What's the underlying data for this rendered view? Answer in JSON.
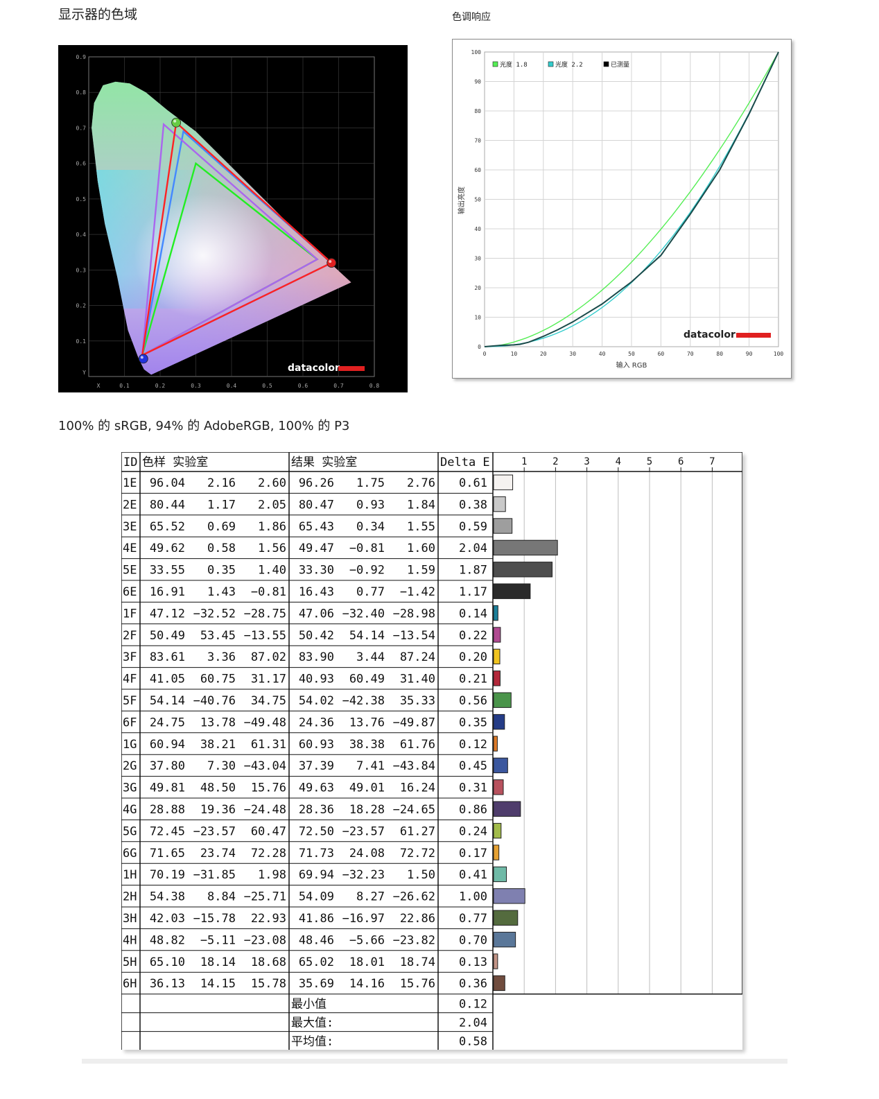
{
  "gamut_title": "显示器的色域",
  "tone_title": "色调响应",
  "coverage_text": "100% 的 sRGB, 94% 的 AdobeRGB, 100% 的 P3",
  "chart_data": [
    {
      "type": "scatter",
      "name": "gamut",
      "x_ticks": [
        "X",
        "0.1",
        "0.2",
        "0.3",
        "0.4",
        "0.5",
        "0.6",
        "0.7",
        "0.8"
      ],
      "y_ticks": [
        "Y",
        "0.1",
        "0.2",
        "0.3",
        "0.4",
        "0.5",
        "0.6",
        "0.7",
        "0.8",
        "0.9"
      ],
      "xlim": [
        0,
        0.8
      ],
      "ylim": [
        0,
        0.9
      ],
      "brand": "datacolor",
      "triangles": [
        {
          "color": "#22ee22",
          "points": [
            [
              0.64,
              0.33
            ],
            [
              0.3,
              0.6
            ],
            [
              0.15,
              0.06
            ]
          ]
        },
        {
          "color": "#4488ff",
          "points": [
            [
              0.68,
              0.32
            ],
            [
              0.265,
              0.69
            ],
            [
              0.15,
              0.06
            ]
          ]
        },
        {
          "color": "#aa66ee",
          "points": [
            [
              0.64,
              0.33
            ],
            [
              0.21,
              0.71
            ],
            [
              0.15,
              0.06
            ]
          ]
        },
        {
          "color": "#ff2222",
          "points": [
            [
              0.68,
              0.32
            ],
            [
              0.245,
              0.715
            ],
            [
              0.15,
              0.06
            ]
          ]
        }
      ],
      "markers": [
        {
          "color": "#e02020",
          "x": 0.68,
          "y": 0.32
        },
        {
          "color": "#66cc44",
          "x": 0.245,
          "y": 0.715
        },
        {
          "color": "#2233dd",
          "x": 0.153,
          "y": 0.05
        }
      ]
    },
    {
      "type": "line",
      "name": "tone",
      "xlabel": "输入 RGB",
      "ylabel": "输出亮度",
      "xlim": [
        0,
        100
      ],
      "ylim": [
        0,
        100
      ],
      "x_ticks": [
        "0",
        "10",
        "20",
        "30",
        "40",
        "50",
        "60",
        "70",
        "80",
        "90",
        "100"
      ],
      "y_ticks": [
        "0",
        "10",
        "20",
        "30",
        "40",
        "50",
        "60",
        "70",
        "80",
        "90",
        "100"
      ],
      "brand": "datacolor",
      "legend": [
        "光度 1.8",
        "光度 2.2",
        "已测量"
      ],
      "series": [
        {
          "name": "光度 1.8",
          "color": "#55ee55",
          "gamma": 1.8
        },
        {
          "name": "光度 2.2",
          "color": "#33cccc",
          "gamma": 2.2
        },
        {
          "name": "已测量",
          "color": "#1a4a4a",
          "x": [
            0,
            5,
            10,
            12,
            15,
            20,
            25,
            30,
            40,
            50,
            60,
            70,
            80,
            90,
            100
          ],
          "y": [
            0,
            0.4,
            0.6,
            0.8,
            1.5,
            3.5,
            5.8,
            8.4,
            14.5,
            22,
            31,
            45,
            60,
            79,
            100
          ]
        }
      ]
    },
    {
      "type": "table",
      "name": "deltae",
      "headers": {
        "id": "ID",
        "sample": "色样 实验室",
        "result": "结果 实验室",
        "delta": "Delta E"
      },
      "bar_ticks": [
        "1",
        "2",
        "3",
        "4",
        "5",
        "6",
        "7"
      ],
      "rows": [
        {
          "id": "1E",
          "s": [
            "96.04",
            "2.16",
            "2.60"
          ],
          "r": [
            "96.26",
            "1.75",
            "2.76"
          ],
          "de": "0.61",
          "color": "#f5f2f0"
        },
        {
          "id": "2E",
          "s": [
            "80.44",
            "1.17",
            "2.05"
          ],
          "r": [
            "80.47",
            "0.93",
            "1.84"
          ],
          "de": "0.38",
          "color": "#c9c9c9"
        },
        {
          "id": "3E",
          "s": [
            "65.52",
            "0.69",
            "1.86"
          ],
          "r": [
            "65.43",
            "0.34",
            "1.55"
          ],
          "de": "0.59",
          "color": "#9e9e9e"
        },
        {
          "id": "4E",
          "s": [
            "49.62",
            "0.58",
            "1.56"
          ],
          "r": [
            "49.47",
            "−0.81",
            "1.60"
          ],
          "de": "2.04",
          "color": "#777777"
        },
        {
          "id": "5E",
          "s": [
            "33.55",
            "0.35",
            "1.40"
          ],
          "r": [
            "33.30",
            "−0.92",
            "1.59"
          ],
          "de": "1.87",
          "color": "#4e4e4e"
        },
        {
          "id": "6E",
          "s": [
            "16.91",
            "1.43",
            "−0.81"
          ],
          "r": [
            "16.43",
            "0.77",
            "−1.42"
          ],
          "de": "1.17",
          "color": "#2a2a2a"
        },
        {
          "id": "1F",
          "s": [
            "47.12",
            "−32.52",
            "−28.75"
          ],
          "r": [
            "47.06",
            "−32.40",
            "−28.98"
          ],
          "de": "0.14",
          "color": "#1b7f9a"
        },
        {
          "id": "2F",
          "s": [
            "50.49",
            "53.45",
            "−13.55"
          ],
          "r": [
            "50.42",
            "54.14",
            "−13.54"
          ],
          "de": "0.22",
          "color": "#b04a91"
        },
        {
          "id": "3F",
          "s": [
            "83.61",
            "3.36",
            "87.02"
          ],
          "r": [
            "83.90",
            "3.44",
            "87.24"
          ],
          "de": "0.20",
          "color": "#f0c41f"
        },
        {
          "id": "4F",
          "s": [
            "41.05",
            "60.75",
            "31.17"
          ],
          "r": [
            "40.93",
            "60.49",
            "31.40"
          ],
          "de": "0.21",
          "color": "#b3283a"
        },
        {
          "id": "5F",
          "s": [
            "54.14",
            "−40.76",
            "34.75"
          ],
          "r": [
            "54.02",
            "−42.38",
            "35.33"
          ],
          "de": "0.56",
          "color": "#4a944a"
        },
        {
          "id": "6F",
          "s": [
            "24.75",
            "13.78",
            "−49.48"
          ],
          "r": [
            "24.36",
            "13.76",
            "−49.87"
          ],
          "de": "0.35",
          "color": "#253c86"
        },
        {
          "id": "1G",
          "s": [
            "60.94",
            "38.21",
            "61.31"
          ],
          "r": [
            "60.93",
            "38.38",
            "61.76"
          ],
          "de": "0.12",
          "color": "#dc7a28"
        },
        {
          "id": "2G",
          "s": [
            "37.80",
            "7.30",
            "−43.04"
          ],
          "r": [
            "37.39",
            "7.41",
            "−43.84"
          ],
          "de": "0.45",
          "color": "#3b579e"
        },
        {
          "id": "3G",
          "s": [
            "49.81",
            "48.50",
            "15.76"
          ],
          "r": [
            "49.63",
            "49.01",
            "16.24"
          ],
          "de": "0.31",
          "color": "#b8525e"
        },
        {
          "id": "4G",
          "s": [
            "28.88",
            "19.36",
            "−24.48"
          ],
          "r": [
            "28.36",
            "18.28",
            "−24.65"
          ],
          "de": "0.86",
          "color": "#4f3d6c"
        },
        {
          "id": "5G",
          "s": [
            "72.45",
            "−23.57",
            "60.47"
          ],
          "r": [
            "72.50",
            "−23.57",
            "61.27"
          ],
          "de": "0.24",
          "color": "#a2bb4a"
        },
        {
          "id": "6G",
          "s": [
            "71.65",
            "23.74",
            "72.28"
          ],
          "r": [
            "71.73",
            "24.08",
            "72.72"
          ],
          "de": "0.17",
          "color": "#e6a132"
        },
        {
          "id": "1H",
          "s": [
            "70.19",
            "−31.85",
            "1.98"
          ],
          "r": [
            "69.94",
            "−32.23",
            "1.50"
          ],
          "de": "0.41",
          "color": "#6fbaa7"
        },
        {
          "id": "2H",
          "s": [
            "54.38",
            "8.84",
            "−25.71"
          ],
          "r": [
            "54.09",
            "8.27",
            "−26.62"
          ],
          "de": "1.00",
          "color": "#7f80b0"
        },
        {
          "id": "3H",
          "s": [
            "42.03",
            "−15.78",
            "22.93"
          ],
          "r": [
            "41.86",
            "−16.97",
            "22.86"
          ],
          "de": "0.77",
          "color": "#546b3e"
        },
        {
          "id": "4H",
          "s": [
            "48.82",
            "−5.11",
            "−23.08"
          ],
          "r": [
            "48.46",
            "−5.66",
            "−23.82"
          ],
          "de": "0.70",
          "color": "#5a7799"
        },
        {
          "id": "5H",
          "s": [
            "65.10",
            "18.14",
            "18.68"
          ],
          "r": [
            "65.02",
            "18.01",
            "18.74"
          ],
          "de": "0.13",
          "color": "#c29486"
        },
        {
          "id": "6H",
          "s": [
            "36.13",
            "14.15",
            "15.78"
          ],
          "r": [
            "35.69",
            "14.16",
            "15.76"
          ],
          "de": "0.36",
          "color": "#704c3e"
        }
      ],
      "summary": [
        {
          "label": "最小值",
          "value": "0.12"
        },
        {
          "label": "最大值:",
          "value": "2.04"
        },
        {
          "label": "平均值:",
          "value": "0.58"
        }
      ]
    }
  ]
}
